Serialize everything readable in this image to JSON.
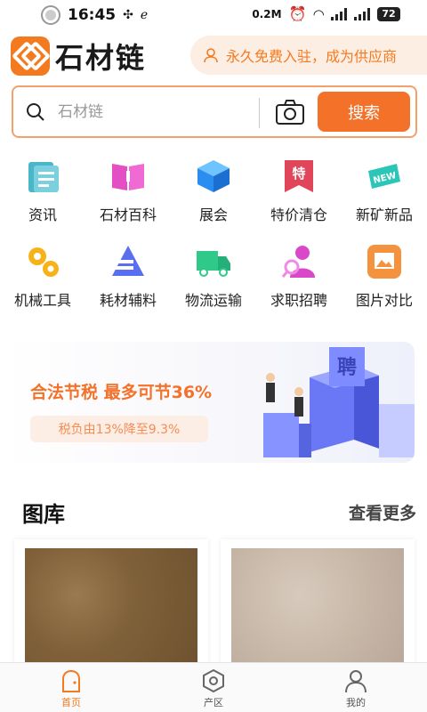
{
  "status_bar": {
    "time": "16:45",
    "net_speed": "0.2M",
    "battery": "72"
  },
  "header": {
    "logo_text": "石材链",
    "join_text": "永久免费入驻，成为供应商"
  },
  "search": {
    "placeholder": "石材链",
    "button_label": "搜索"
  },
  "categories": [
    {
      "label": "资讯",
      "icon": "news-icon"
    },
    {
      "label": "石材百科",
      "icon": "book-icon"
    },
    {
      "label": "展会",
      "icon": "cube-icon"
    },
    {
      "label": "特价清仓",
      "icon": "bookmark-special-icon"
    },
    {
      "label": "新矿新品",
      "icon": "new-tag-icon"
    },
    {
      "label": "机械工具",
      "icon": "gears-icon"
    },
    {
      "label": "耗材辅料",
      "icon": "layers-icon"
    },
    {
      "label": "物流运输",
      "icon": "truck-icon"
    },
    {
      "label": "求职招聘",
      "icon": "job-search-icon"
    },
    {
      "label": "图片对比",
      "icon": "image-compare-icon"
    }
  ],
  "banner": {
    "title": "合法节税  最多可节36%",
    "subtitle": "税负由13%降至9.3%",
    "sign_text": "聘"
  },
  "gallery": {
    "title": "图库",
    "more": "查看更多"
  },
  "tabs": [
    {
      "label": "首页",
      "active": true
    },
    {
      "label": "产区",
      "active": false
    },
    {
      "label": "我的",
      "active": false
    }
  ],
  "colors": {
    "accent": "#f47a20",
    "accent_light": "#fdeee3"
  }
}
